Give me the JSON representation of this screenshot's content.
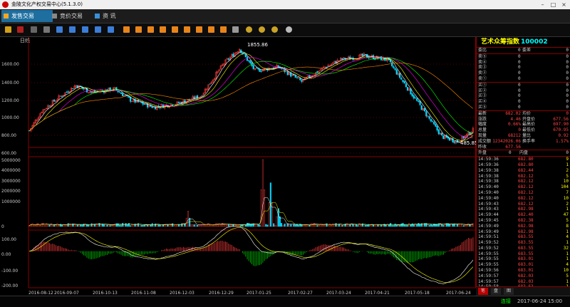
{
  "window": {
    "title": "金陵文化产权交易中心(5.1.3.0)"
  },
  "nav": {
    "tabs": [
      {
        "label": "发售交易"
      },
      {
        "label": "竞价交易"
      },
      {
        "label": "资  讯"
      }
    ]
  },
  "chart": {
    "period_label": "日线",
    "price_axis": [
      "1600.00",
      "1400.00",
      "1200.00",
      "1000.00",
      "800.00",
      "600.00"
    ],
    "volume_axis": [
      "5000000",
      "4000000",
      "3000000",
      "2000000",
      "1000000",
      "0"
    ],
    "macd_axis": [
      "100.00",
      "0.00",
      "-100.00",
      "-200.00"
    ],
    "date_axis": [
      "2016-08-12",
      "2016-09-07",
      "2016-10-13",
      "2016-11-08",
      "2016-12-03",
      "2016-12-29",
      "2017-01-25",
      "2017-02-27",
      "2017-03-24",
      "2017-04-21",
      "2017-05-18",
      "2017-06-24"
    ],
    "high_label": "1855.86",
    "low_label": "485.85",
    "colors": {
      "up": "#ff3c3c",
      "down": "#00d8ff",
      "ma5": "#ffffff",
      "ma10": "#ffff00",
      "ma20": "#ff00ff",
      "ma30": "#00ff00",
      "ma60": "#ff8c00"
    }
  },
  "chart_data": {
    "type": "candlestick",
    "x_start": "2016-08-12",
    "x_end": "2017-06-24",
    "ylim": [
      480,
      1880
    ],
    "close_keypoints": [
      [
        0,
        680
      ],
      [
        8,
        950
      ],
      [
        20,
        1150
      ],
      [
        30,
        1300
      ],
      [
        40,
        1200
      ],
      [
        55,
        1250
      ],
      [
        65,
        1100
      ],
      [
        80,
        1000
      ],
      [
        95,
        1050
      ],
      [
        110,
        1150
      ],
      [
        125,
        1600
      ],
      [
        135,
        1800
      ],
      [
        145,
        1500
      ],
      [
        160,
        1550
      ],
      [
        175,
        1350
      ],
      [
        190,
        1550
      ],
      [
        200,
        1650
      ],
      [
        215,
        1700
      ],
      [
        230,
        1650
      ],
      [
        240,
        1350
      ],
      [
        255,
        900
      ],
      [
        265,
        600
      ],
      [
        275,
        530
      ],
      [
        285,
        685
      ]
    ],
    "volume": [
      {
        "index": 102,
        "value": 1200000
      },
      {
        "index": 150,
        "value": 5200000
      },
      {
        "index": 155,
        "value": 3400000
      },
      {
        "index": 160,
        "value": 1400000
      }
    ],
    "macd_range": [
      -200,
      100
    ]
  },
  "quote": {
    "title_name": "艺术众筹指数",
    "title_code": "100002",
    "order_rows": [
      {
        "label": "委比",
        "a": "0",
        "b": "委差",
        "c": "0"
      },
      {
        "label": "卖⑤",
        "a": "0",
        "b": "",
        "c": "0"
      },
      {
        "label": "卖④",
        "a": "0",
        "b": "",
        "c": "0"
      },
      {
        "label": "卖③",
        "a": "0",
        "b": "",
        "c": "0"
      },
      {
        "label": "卖②",
        "a": "0",
        "b": "",
        "c": "0"
      },
      {
        "label": "卖①",
        "a": "0",
        "b": "",
        "c": "0"
      },
      {
        "label": "买①",
        "a": "0",
        "b": "",
        "c": "0"
      },
      {
        "label": "买②",
        "a": "0",
        "b": "",
        "c": "0"
      },
      {
        "label": "买③",
        "a": "0",
        "b": "",
        "c": "0"
      },
      {
        "label": "买④",
        "a": "0",
        "b": "",
        "c": "0"
      },
      {
        "label": "买⑤",
        "a": "0",
        "b": "",
        "c": "0"
      }
    ],
    "stat_rows": [
      {
        "l1": "最新",
        "v1": "682.02",
        "l2": "均价",
        "v2": "0"
      },
      {
        "l1": "涨跌",
        "v1": "4.46",
        "l2": "开盘价",
        "v2": "677.56"
      },
      {
        "l1": "幅度",
        "v1": "0.66%",
        "l2": "最高价",
        "v2": "697.90"
      },
      {
        "l1": "总量",
        "v1": "0",
        "l2": "最低价",
        "v2": "670.95"
      },
      {
        "l1": "现量",
        "v1": "68212",
        "l2": "量比",
        "v2": "0.92"
      },
      {
        "l1": "成交额",
        "v1": "12342026.06",
        "l2": "换手率",
        "v2": "1.57%"
      },
      {
        "l1": "昨收",
        "v1": "677.56",
        "l2": "",
        "v2": ""
      }
    ],
    "pan": {
      "l1": "外盘",
      "v1": "0",
      "l2": "内盘",
      "v2": "0"
    },
    "trades": [
      {
        "t": "14:59:36",
        "p": "682.80",
        "v": "9"
      },
      {
        "t": "14:59:36",
        "p": "682.80",
        "v": "1"
      },
      {
        "t": "14:59:38",
        "p": "682.44",
        "v": "2"
      },
      {
        "t": "14:59:38",
        "p": "682.12",
        "v": "5"
      },
      {
        "t": "14:59:38",
        "p": "682.12",
        "v": "10"
      },
      {
        "t": "14:59:40",
        "p": "682.12",
        "v": "104"
      },
      {
        "t": "14:59:40",
        "p": "682.12",
        "v": "7"
      },
      {
        "t": "14:59:40",
        "p": "682.12",
        "v": "10"
      },
      {
        "t": "14:59:43",
        "p": "682.12",
        "v": "2"
      },
      {
        "t": "14:59:43",
        "p": "682.98",
        "v": "1"
      },
      {
        "t": "14:59:44",
        "p": "682.40",
        "v": "47"
      },
      {
        "t": "14:59:45",
        "p": "682.38",
        "v": "5"
      },
      {
        "t": "14:59:49",
        "p": "682.98",
        "v": "8"
      },
      {
        "t": "14:59:49",
        "p": "682.98",
        "v": "1"
      },
      {
        "t": "14:59:51",
        "p": "683.55",
        "v": "4"
      },
      {
        "t": "14:59:52",
        "p": "683.55",
        "v": "1"
      },
      {
        "t": "14:59:52",
        "p": "683.55",
        "v": "32"
      },
      {
        "t": "14:59:55",
        "p": "683.55",
        "v": "1"
      },
      {
        "t": "14:59:55",
        "p": "683.01",
        "v": "1"
      },
      {
        "t": "14:59:55",
        "p": "683.01",
        "v": "4"
      },
      {
        "t": "14:59:56",
        "p": "683.01",
        "v": "10"
      },
      {
        "t": "14:59:57",
        "p": "682.03",
        "v": "5"
      },
      {
        "t": "14:59:57",
        "p": "682.03",
        "v": "1"
      },
      {
        "t": "14:59:58",
        "p": "683.63",
        "v": "1"
      },
      {
        "t": "14:59:59",
        "p": "682.03",
        "v": "9"
      },
      {
        "t": "14:59:59",
        "p": "683.10",
        "v": "1"
      }
    ],
    "tabs": [
      "笔",
      "盘",
      "图"
    ]
  },
  "status": {
    "connection": "连接",
    "datetime": "2017-06-24 15:00"
  }
}
